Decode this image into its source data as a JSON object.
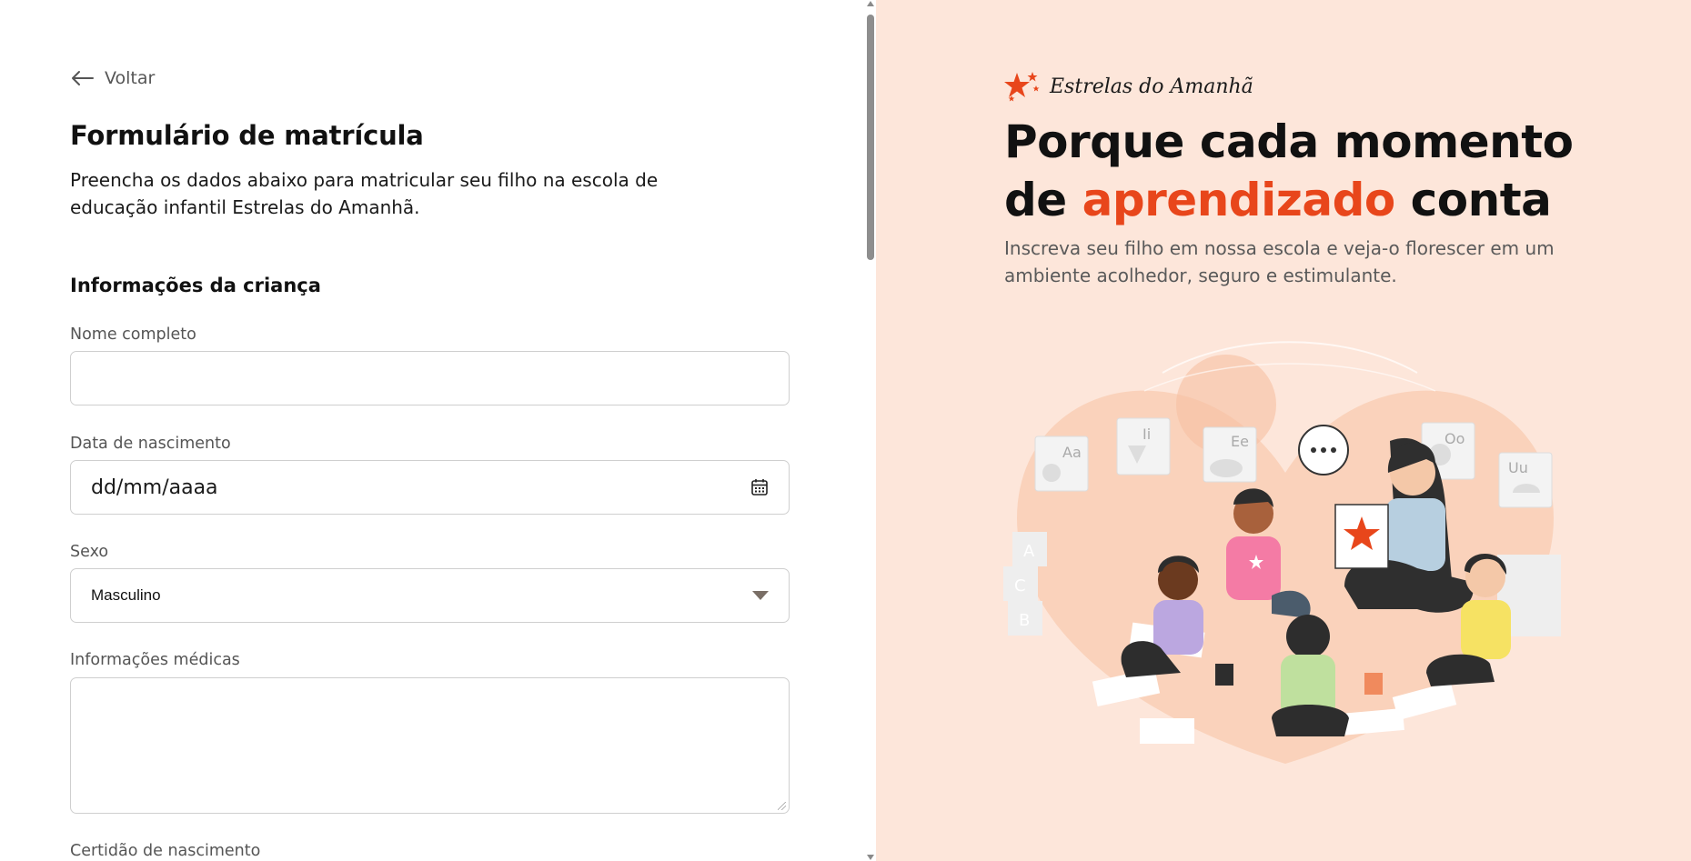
{
  "back": {
    "label": "Voltar"
  },
  "form": {
    "title": "Formulário de matrícula",
    "description": "Preencha os dados abaixo para matricular seu filho na escola de educação infantil Estrelas do Amanhã.",
    "section_child": "Informações da criança",
    "fields": {
      "full_name": {
        "label": "Nome completo",
        "value": ""
      },
      "birth_date": {
        "label": "Data de nascimento",
        "placeholder": "dd/mm/aaaa"
      },
      "sex": {
        "label": "Sexo",
        "value": "Masculino"
      },
      "medical": {
        "label": "Informações médicas",
        "value": ""
      },
      "birth_certificate": {
        "label": "Certidão de nascimento"
      }
    }
  },
  "hero": {
    "brand_name": "Estrelas do Amanhã",
    "title_part1": "Porque cada momento de ",
    "title_accent": "aprendizado",
    "title_part2": " conta",
    "subtitle": "Inscreva seu filho em nossa escola e veja-o florescer em um ambiente acolhedor, seguro e estimulante.",
    "illustration_letters": [
      "Aa",
      "Ii",
      "Ee",
      "Oo",
      "Uu",
      "A",
      "C",
      "B"
    ]
  },
  "colors": {
    "accent": "#e8461b",
    "right_bg": "#fde6da",
    "text_dark": "#111111",
    "text_muted": "#5a5a5a"
  }
}
